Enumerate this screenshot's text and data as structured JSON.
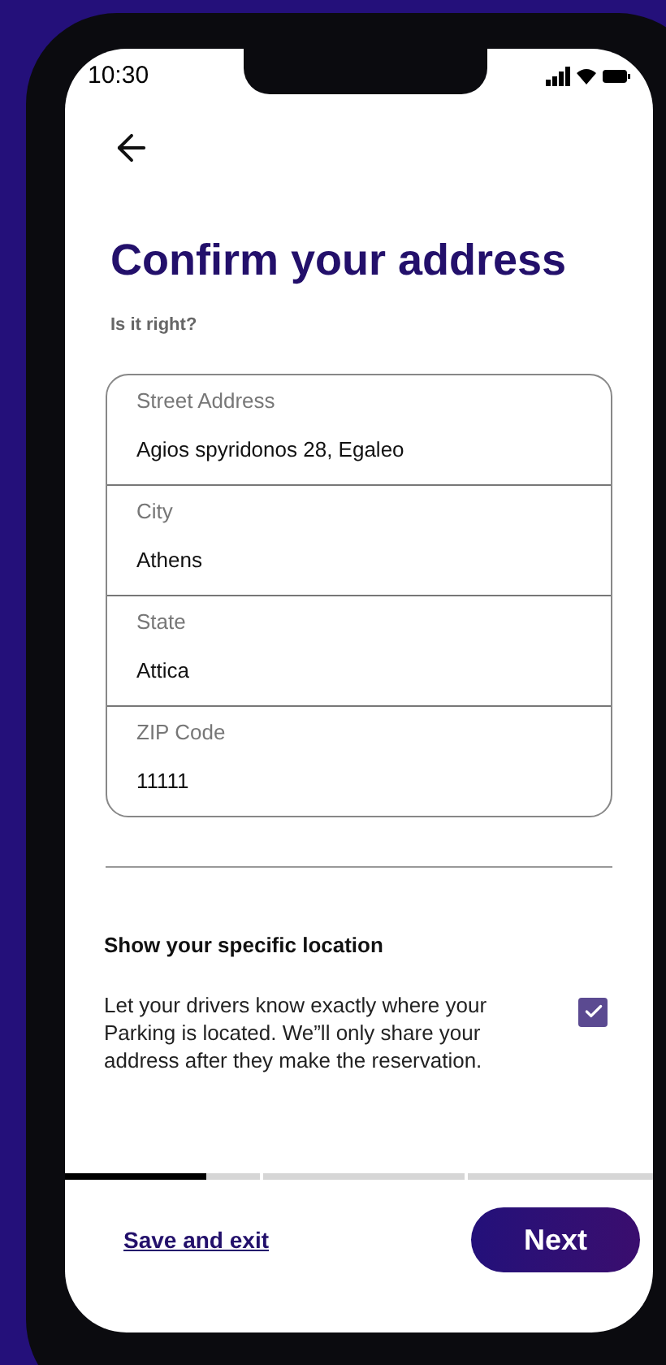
{
  "status_bar": {
    "time": "10:30"
  },
  "title": "Confirm your address",
  "subtitle": "Is it right?",
  "fields": [
    {
      "label": "Street Address",
      "value": "Agios spyridonos 28, Egaleo"
    },
    {
      "label": "City",
      "value": "Athens"
    },
    {
      "label": "State",
      "value": "Attica"
    },
    {
      "label": "ZIP Code",
      "value": "11111"
    }
  ],
  "location": {
    "heading": "Show your specific location",
    "description": "Let your drivers know exactly where your Parking is located. We”ll only share your address after they make the reservation.",
    "checked": true
  },
  "progress": {
    "level": 0.24
  },
  "footer": {
    "link": "Save and exit",
    "button": "Next"
  }
}
